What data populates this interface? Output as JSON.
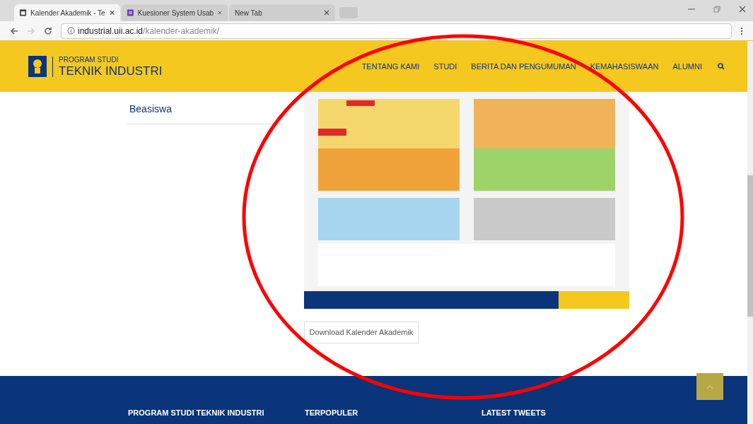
{
  "browser": {
    "tabs": [
      {
        "title": "Kalender Akademik - Te",
        "selected": true,
        "kind": "page"
      },
      {
        "title": "Kuesioner System Usab",
        "selected": false,
        "kind": "form"
      },
      {
        "title": "New Tab",
        "selected": false,
        "kind": "blank"
      }
    ],
    "url_host": "industrial.uii.ac.id",
    "url_path": "/kalender-akademik/"
  },
  "header": {
    "logo_line_1": "PROGRAM STUDI",
    "logo_line_2": "TEKNIK INDUSTRI",
    "nav": [
      "TENTANG KAMI",
      "STUDI",
      "BERITA DAN PENGUMUMAN",
      "KEMAHASISWAAN",
      "ALUMNI"
    ]
  },
  "sidebar": {
    "items": [
      "Beasiswa"
    ]
  },
  "content": {
    "download_button": "Download Kalender Akademik"
  },
  "footer": {
    "headings": [
      "PROGRAM STUDI TEKNIK INDUSTRI",
      "TERPOPULER",
      "LATEST TWEETS"
    ]
  }
}
